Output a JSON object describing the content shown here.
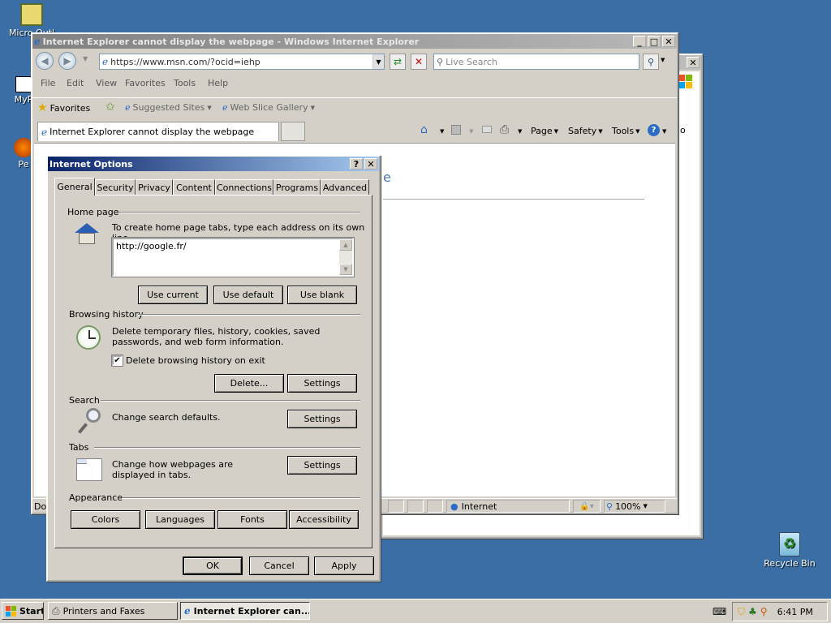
{
  "desktop": {
    "icons": [
      {
        "label": "Micro Outl",
        "icon": "outlook-icon"
      },
      {
        "label": "MyP",
        "icon": "shortcut-icon"
      },
      {
        "label": "Pe",
        "icon": "shortcut-icon"
      },
      {
        "label": "Recycle Bin",
        "icon": "recycle-bin-icon"
      }
    ]
  },
  "ie": {
    "title": "Internet Explorer cannot display the webpage - Windows Internet Explorer",
    "address": "https://www.msn.com/?ocid=iehp",
    "search_placeholder": "Live Search",
    "menu": [
      "File",
      "Edit",
      "View",
      "Favorites",
      "Tools",
      "Help"
    ],
    "favorites_label": "Favorites",
    "suggested_sites": "Suggested Sites",
    "web_slice_gallery": "Web Slice Gallery",
    "tab_title": "Internet Explorer cannot display the webpage",
    "commands": {
      "page": "Page",
      "safety": "Safety",
      "tools": "Tools"
    },
    "page_heading_fragment": "e",
    "status": {
      "left": "Dor",
      "zone": "Internet",
      "zoom": "100%"
    },
    "back_window_tab_fragment": "o"
  },
  "options": {
    "title": "Internet Options",
    "help_btn": "?",
    "close_btn": "✕",
    "tabs": [
      "General",
      "Security",
      "Privacy",
      "Content",
      "Connections",
      "Programs",
      "Advanced"
    ],
    "home_page": {
      "title": "Home page",
      "desc": "To create home page tabs, type each address on its own line.",
      "value": "http://google.fr/",
      "use_current": "Use current",
      "use_default": "Use default",
      "use_blank": "Use blank"
    },
    "history": {
      "title": "Browsing history",
      "desc": "Delete temporary files, history, cookies, saved passwords, and web form information.",
      "checkbox": "Delete browsing history on exit",
      "checked": true,
      "delete": "Delete...",
      "settings": "Settings"
    },
    "search": {
      "title": "Search",
      "desc": "Change search defaults.",
      "settings": "Settings"
    },
    "tabs_group": {
      "title": "Tabs",
      "desc": "Change how webpages are displayed in tabs.",
      "settings": "Settings"
    },
    "appearance": {
      "title": "Appearance",
      "colors": "Colors",
      "languages": "Languages",
      "fonts": "Fonts",
      "accessibility": "Accessibility"
    },
    "ok": "OK",
    "cancel": "Cancel",
    "apply": "Apply"
  },
  "taskbar": {
    "start": "Start",
    "items": [
      "Printers and Faxes",
      "Internet Explorer can..."
    ],
    "clock": "6:41 PM"
  }
}
